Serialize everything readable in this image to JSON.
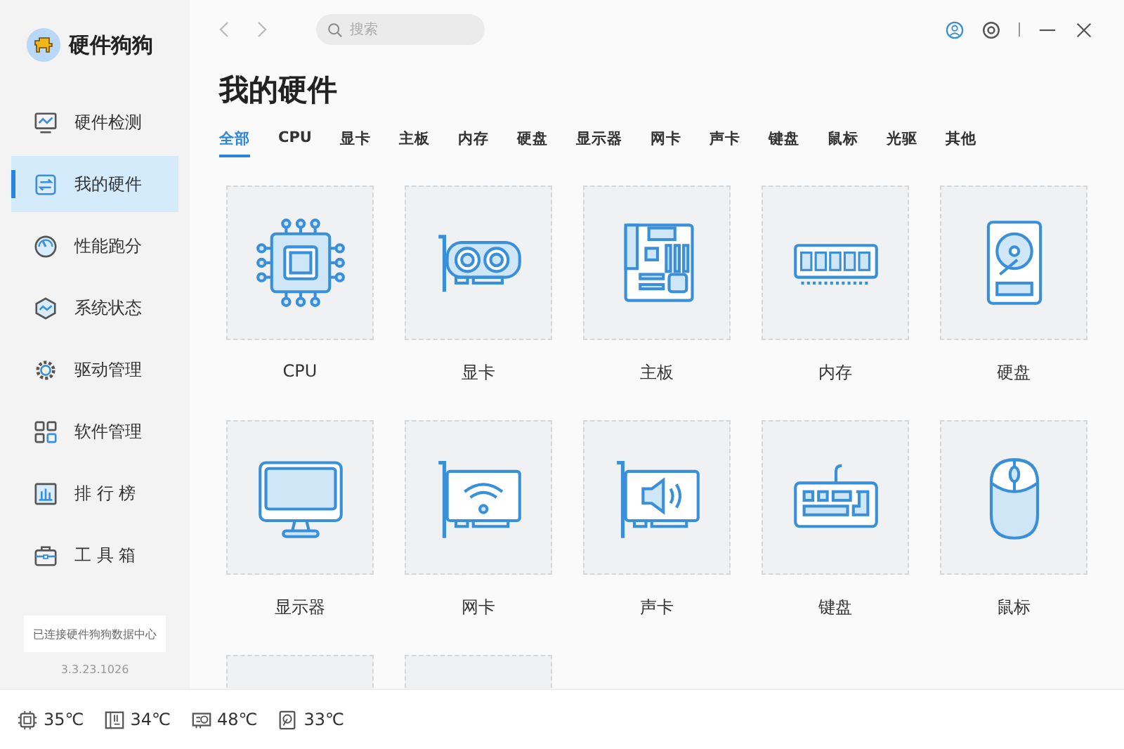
{
  "app": {
    "name": "硬件狗狗"
  },
  "sidebar": {
    "items": [
      {
        "label": "硬件检测",
        "kind": "monitor",
        "selected": false
      },
      {
        "label": "我的硬件",
        "kind": "hardware",
        "selected": true
      },
      {
        "label": "性能跑分",
        "kind": "gauge",
        "selected": false
      },
      {
        "label": "系统状态",
        "kind": "status",
        "selected": false
      },
      {
        "label": "驱动管理",
        "kind": "gear",
        "selected": false
      },
      {
        "label": "软件管理",
        "kind": "apps",
        "selected": false
      },
      {
        "label": "排 行 榜",
        "kind": "chart",
        "selected": false
      },
      {
        "label": "工 具 箱",
        "kind": "toolbox",
        "selected": false
      }
    ],
    "connection": "已连接硬件狗狗数据中心",
    "version": "3.3.23.1026"
  },
  "search": {
    "placeholder": "搜索"
  },
  "page_title": "我的硬件",
  "tabs": [
    {
      "label": "全部",
      "selected": true
    },
    {
      "label": "CPU",
      "selected": false
    },
    {
      "label": "显卡",
      "selected": false
    },
    {
      "label": "主板",
      "selected": false
    },
    {
      "label": "内存",
      "selected": false
    },
    {
      "label": "硬盘",
      "selected": false
    },
    {
      "label": "显示器",
      "selected": false
    },
    {
      "label": "网卡",
      "selected": false
    },
    {
      "label": "声卡",
      "selected": false
    },
    {
      "label": "键盘",
      "selected": false
    },
    {
      "label": "鼠标",
      "selected": false
    },
    {
      "label": "光驱",
      "selected": false
    },
    {
      "label": "其他",
      "selected": false
    }
  ],
  "hardware": [
    {
      "kind": "cpu",
      "label": "CPU"
    },
    {
      "kind": "gpu",
      "label": "显卡"
    },
    {
      "kind": "motherboard",
      "label": "主板"
    },
    {
      "kind": "memory",
      "label": "内存"
    },
    {
      "kind": "disk",
      "label": "硬盘"
    },
    {
      "kind": "monitor",
      "label": "显示器"
    },
    {
      "kind": "network",
      "label": "网卡"
    },
    {
      "kind": "sound",
      "label": "声卡"
    },
    {
      "kind": "keyboard",
      "label": "键盘"
    },
    {
      "kind": "mouse",
      "label": "鼠标"
    },
    {
      "kind": "clipped"
    },
    {
      "kind": "clipped"
    }
  ],
  "status_bar": [
    {
      "kind": "cpu",
      "reading": "35℃"
    },
    {
      "kind": "board",
      "reading": "34℃"
    },
    {
      "kind": "gpu",
      "reading": "48℃"
    },
    {
      "kind": "disk",
      "reading": "33℃"
    }
  ]
}
